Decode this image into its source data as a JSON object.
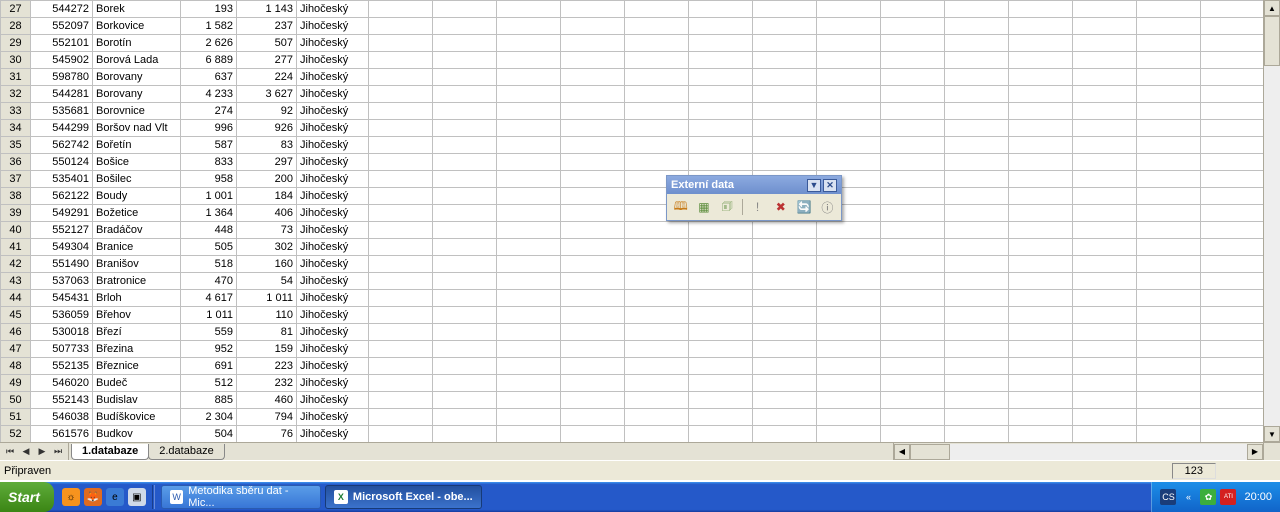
{
  "grid": {
    "rows": [
      {
        "n": 27,
        "b": "544272",
        "c": "Borek",
        "d": "193",
        "e": "1 143",
        "f": "Jihočeský"
      },
      {
        "n": 28,
        "b": "552097",
        "c": "Borkovice",
        "d": "1 582",
        "e": "237",
        "f": "Jihočeský"
      },
      {
        "n": 29,
        "b": "552101",
        "c": "Borotín",
        "d": "2 626",
        "e": "507",
        "f": "Jihočeský"
      },
      {
        "n": 30,
        "b": "545902",
        "c": "Borová Lada",
        "d": "6 889",
        "e": "277",
        "f": "Jihočeský"
      },
      {
        "n": 31,
        "b": "598780",
        "c": "Borovany",
        "d": "637",
        "e": "224",
        "f": "Jihočeský"
      },
      {
        "n": 32,
        "b": "544281",
        "c": "Borovany",
        "d": "4 233",
        "e": "3 627",
        "f": "Jihočeský"
      },
      {
        "n": 33,
        "b": "535681",
        "c": "Borovnice",
        "d": "274",
        "e": "92",
        "f": "Jihočeský"
      },
      {
        "n": 34,
        "b": "544299",
        "c": "Boršov nad Vlt",
        "d": "996",
        "e": "926",
        "f": "Jihočeský"
      },
      {
        "n": 35,
        "b": "562742",
        "c": "Bořetín",
        "d": "587",
        "e": "83",
        "f": "Jihočeský"
      },
      {
        "n": 36,
        "b": "550124",
        "c": "Bošice",
        "d": "833",
        "e": "297",
        "f": "Jihočeský"
      },
      {
        "n": 37,
        "b": "535401",
        "c": "Bošilec",
        "d": "958",
        "e": "200",
        "f": "Jihočeský"
      },
      {
        "n": 38,
        "b": "562122",
        "c": "Boudy",
        "d": "1 001",
        "e": "184",
        "f": "Jihočeský"
      },
      {
        "n": 39,
        "b": "549291",
        "c": "Božetice",
        "d": "1 364",
        "e": "406",
        "f": "Jihočeský"
      },
      {
        "n": 40,
        "b": "552127",
        "c": "Bradáčov",
        "d": "448",
        "e": "73",
        "f": "Jihočeský"
      },
      {
        "n": 41,
        "b": "549304",
        "c": "Branice",
        "d": "505",
        "e": "302",
        "f": "Jihočeský"
      },
      {
        "n": 42,
        "b": "551490",
        "c": "Branišov",
        "d": "518",
        "e": "160",
        "f": "Jihočeský"
      },
      {
        "n": 43,
        "b": "537063",
        "c": "Bratronice",
        "d": "470",
        "e": "54",
        "f": "Jihočeský"
      },
      {
        "n": 44,
        "b": "545431",
        "c": "Brloh",
        "d": "4 617",
        "e": "1 011",
        "f": "Jihočeský"
      },
      {
        "n": 45,
        "b": "536059",
        "c": "Břehov",
        "d": "1 011",
        "e": "110",
        "f": "Jihočeský"
      },
      {
        "n": 46,
        "b": "530018",
        "c": "Březí",
        "d": "559",
        "e": "81",
        "f": "Jihočeský"
      },
      {
        "n": 47,
        "b": "507733",
        "c": "Březina",
        "d": "952",
        "e": "159",
        "f": "Jihočeský"
      },
      {
        "n": 48,
        "b": "552135",
        "c": "Březnice",
        "d": "691",
        "e": "223",
        "f": "Jihočeský"
      },
      {
        "n": 49,
        "b": "546020",
        "c": "Budeč",
        "d": "512",
        "e": "232",
        "f": "Jihočeský"
      },
      {
        "n": 50,
        "b": "552143",
        "c": "Budislav",
        "d": "885",
        "e": "460",
        "f": "Jihočeský"
      },
      {
        "n": 51,
        "b": "546038",
        "c": "Budíškovice",
        "d": "2 304",
        "e": "794",
        "f": "Jihočeský"
      },
      {
        "n": 52,
        "b": "561576",
        "c": "Budkov",
        "d": "504",
        "e": "76",
        "f": "Jihočeský"
      }
    ]
  },
  "sheets": {
    "tab1": "1.databaze",
    "tab2": "2.databaze"
  },
  "status": {
    "ready": "Připraven",
    "num": "123"
  },
  "floating": {
    "title": "Externí data"
  },
  "taskbar": {
    "start": "Start",
    "task1": "Metodika sběru dat - Mic...",
    "task2": "Microsoft Excel - obe...",
    "clock": "20:00",
    "lang": "CS"
  }
}
